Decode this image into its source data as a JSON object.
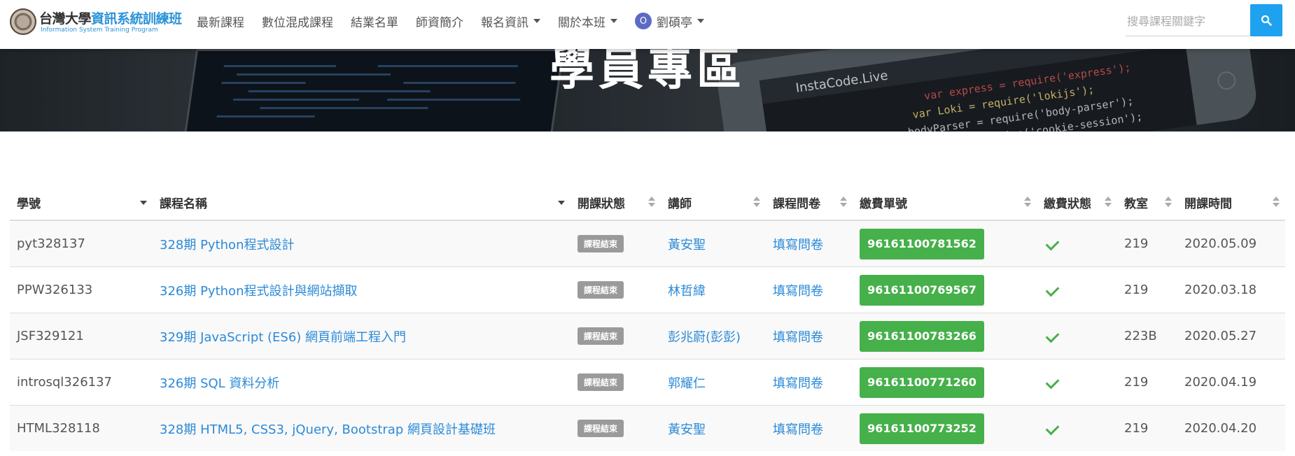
{
  "header": {
    "brand_title_part1": "台灣大學",
    "brand_title_part2": "資訊系統訓練班",
    "brand_subtitle": "Information System Training Program",
    "nav": [
      {
        "label": "最新課程"
      },
      {
        "label": "數位混成課程"
      },
      {
        "label": "結業名單"
      },
      {
        "label": "師資簡介"
      },
      {
        "label": "報名資訊"
      },
      {
        "label": "關於本班"
      }
    ],
    "user": {
      "initial": "O",
      "name": "劉碩亭"
    },
    "search": {
      "placeholder": "搜尋課程關鍵字",
      "icon": "search-icon"
    }
  },
  "hero": {
    "title": "學員專區",
    "screen_text": "InstaCode.Live",
    "code_lines": [
      "var express = require('express');",
      "var Loki = require('lokijs');",
      "bodyParser = require('body-parser');",
      "require('cookie-session');"
    ]
  },
  "table": {
    "columns": [
      "學號",
      "課程名稱",
      "開課狀態",
      "講師",
      "課程問卷",
      "繳費單號",
      "繳費狀態",
      "教室",
      "開課時間"
    ],
    "rows": [
      {
        "id": "pyt328137",
        "course": "328期 Python程式設計",
        "status": "課程結束",
        "teacher": "黃安聖",
        "survey": "填寫問卷",
        "bill": "96161100781562",
        "paid": true,
        "room": "219",
        "date": "2020.05.09"
      },
      {
        "id": "PPW326133",
        "course": "326期 Python程式設計與網站擷取",
        "status": "課程結束",
        "teacher": "林哲緯",
        "survey": "填寫問卷",
        "bill": "96161100769567",
        "paid": true,
        "room": "219",
        "date": "2020.03.18"
      },
      {
        "id": "JSF329121",
        "course": "329期 JavaScript (ES6) 網頁前端工程入門",
        "status": "課程結束",
        "teacher": "彭兆蔚(彭彭)",
        "survey": "填寫問卷",
        "bill": "96161100783266",
        "paid": true,
        "room": "223B",
        "date": "2020.05.27"
      },
      {
        "id": "introsql326137",
        "course": "326期 SQL 資料分析",
        "status": "課程結束",
        "teacher": "郭耀仁",
        "survey": "填寫問卷",
        "bill": "96161100771260",
        "paid": true,
        "room": "219",
        "date": "2020.04.19"
      },
      {
        "id": "HTML328118",
        "course": "328期 HTML5, CSS3, jQuery, Bootstrap 網頁設計基礎班",
        "status": "課程結束",
        "teacher": "黃安聖",
        "survey": "填寫問卷",
        "bill": "96161100773252",
        "paid": true,
        "room": "219",
        "date": "2020.04.20"
      }
    ]
  },
  "colors": {
    "accent": "#1ea1ef",
    "pay_button": "#46b04a",
    "link": "#2b8ad8",
    "badge": "#9a9a9a"
  }
}
